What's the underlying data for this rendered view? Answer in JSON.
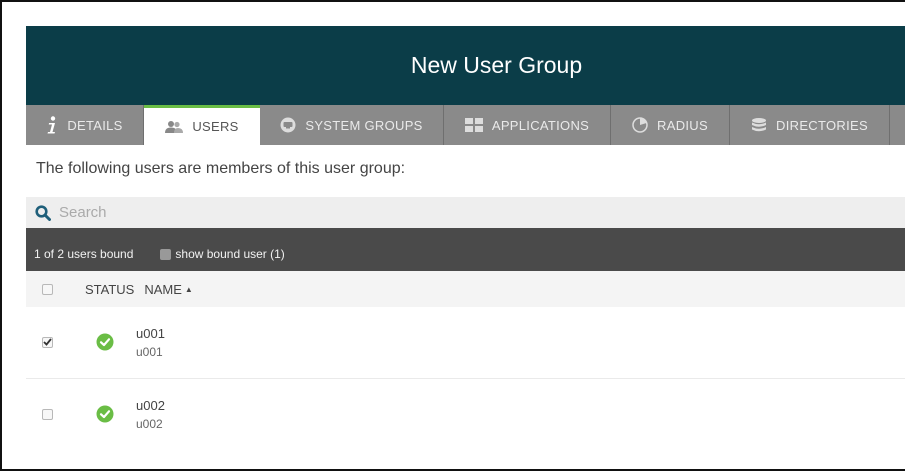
{
  "header": {
    "title": "New User Group"
  },
  "tabs": [
    {
      "label": "DETAILS",
      "icon": "info-icon",
      "active": false
    },
    {
      "label": "USERS",
      "icon": "users-icon",
      "active": true
    },
    {
      "label": "SYSTEM GROUPS",
      "icon": "system-groups-icon",
      "active": false
    },
    {
      "label": "APPLICATIONS",
      "icon": "applications-icon",
      "active": false
    },
    {
      "label": "RADIUS",
      "icon": "radius-icon",
      "active": false
    },
    {
      "label": "DIRECTORIES",
      "icon": "directories-icon",
      "active": false
    }
  ],
  "intro": "The following users are members of this user group:",
  "search": {
    "placeholder": "Search",
    "value": ""
  },
  "bound": {
    "count_text": "1 of 2 users bound",
    "show_label": "show bound user (1)",
    "show_checked": false
  },
  "table": {
    "columns": {
      "status": "STATUS",
      "name": "NAME"
    },
    "sort_indicator": "▲",
    "rows": [
      {
        "name": "u001",
        "username": "u001",
        "checked": true,
        "status": "active"
      },
      {
        "name": "u002",
        "username": "u002",
        "checked": false,
        "status": "active"
      }
    ]
  },
  "colors": {
    "header_bg": "#0b3d48",
    "tab_bg": "#8a8a8a",
    "active_tab_accent": "#6abd45",
    "status_ok": "#6abd45",
    "bound_bar_bg": "#4a4a4a",
    "search_icon": "#1f5f7a"
  }
}
